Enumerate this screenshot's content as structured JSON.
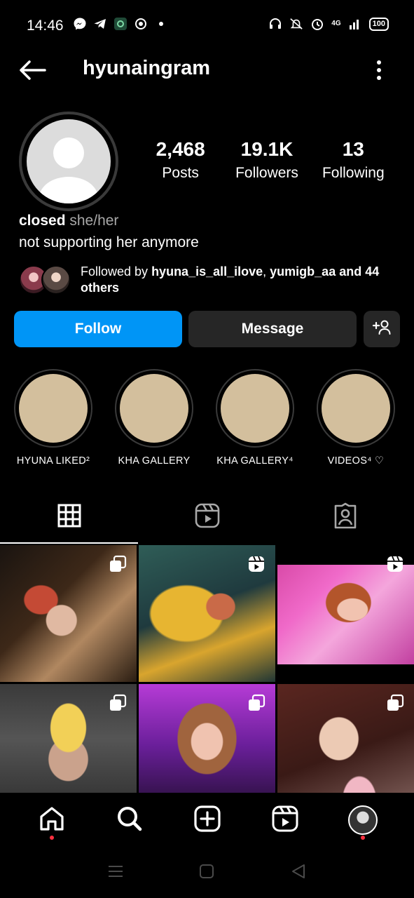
{
  "status_bar": {
    "time": "14:46",
    "battery": "100",
    "network": "4G",
    "icons_left": [
      "messenger-icon",
      "telegram-icon",
      "app-icon",
      "target-icon",
      "dot-icon"
    ],
    "icons_right": [
      "headset-icon",
      "muted-bell-icon",
      "alarm-icon",
      "signal-icon",
      "battery-icon"
    ]
  },
  "header": {
    "username": "hyunaingram",
    "back_icon": "arrow-left-icon",
    "menu_icon": "more-vertical-icon"
  },
  "profile": {
    "stats": [
      {
        "value": "2,468",
        "label": "Posts"
      },
      {
        "value": "19.1K",
        "label": "Followers"
      },
      {
        "value": "13",
        "label": "Following"
      }
    ],
    "display_name": "closed",
    "pronouns": "she/her",
    "bio": "not supporting her anymore",
    "followed_by": {
      "prefix": "Followed by ",
      "user1": "hyuna_is_all_ilove",
      "separator": ", ",
      "user2": "yumigb_aa",
      "suffix": " and 44 others"
    }
  },
  "actions": {
    "follow": "Follow",
    "message": "Message",
    "add_user_icon": "add-person-icon"
  },
  "highlights": [
    {
      "label": "HYUNA LIKED²"
    },
    {
      "label": "KHA GALLERY"
    },
    {
      "label": "KHA GALLERY⁴"
    },
    {
      "label": "VIDEOS⁴ ♡"
    }
  ],
  "tabs": [
    {
      "icon": "grid-icon",
      "active": true
    },
    {
      "icon": "reels-icon",
      "active": false
    },
    {
      "icon": "tagged-icon",
      "active": false
    }
  ],
  "posts": [
    {
      "type": "carousel"
    },
    {
      "type": "reel"
    },
    {
      "type": "reel"
    },
    {
      "type": "carousel"
    },
    {
      "type": "carousel"
    },
    {
      "type": "carousel"
    }
  ],
  "bottom_nav": [
    "home-icon",
    "search-icon",
    "create-icon",
    "reels-icon",
    "profile-avatar"
  ],
  "colors": {
    "follow_button": "#0095f6",
    "secondary_button": "#262626",
    "highlight_fill": "#d3bf9d",
    "notification_dot": "#ff3040"
  }
}
